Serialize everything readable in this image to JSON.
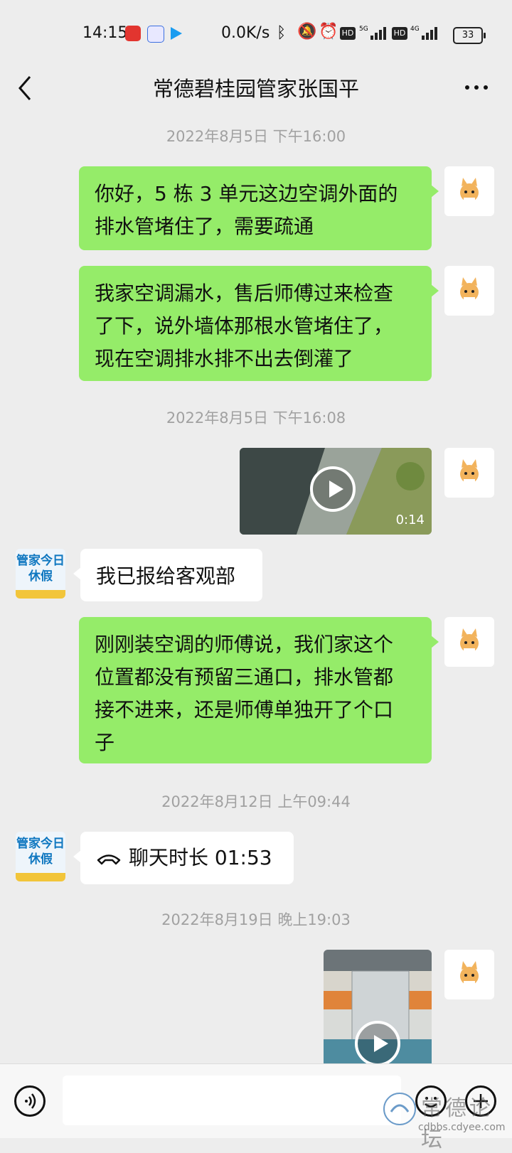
{
  "status_bar": {
    "time": "14:15",
    "speed": "0.0K/s",
    "battery": "33",
    "icons": [
      "bluetooth-icon",
      "mute-icon",
      "alarm-icon",
      "hd-icon",
      "5g-signal-icon",
      "hd-icon",
      "4g-signal-icon"
    ]
  },
  "header": {
    "title": "常德碧桂园管家张国平"
  },
  "messages": {
    "ts1": "2022年8月5日 下午16:00",
    "m1_line1": "你好，5 栋 3 单元这边空调外面的",
    "m1_line2": "排水管堵住了，需要疏通",
    "m2_line1": "我家空调漏水，售后师傅过来检查",
    "m2_line2": "了下，说外墙体那根水管堵住了，",
    "m2_line3": "现在空调排水排不出去倒灌了",
    "ts2": "2022年8月5日 下午16:08",
    "video1_duration": "0:14",
    "m3": "我已报给客观部",
    "m4_line1": "刚刚装空调的师傅说，我们家这个",
    "m4_line2": "位置都没有预留三通口，排水管都",
    "m4_line3": "接不进来，还是师傅单独开了个口",
    "m4_line4": "子",
    "ts3": "2022年8月12日 上午09:44",
    "call": "聊天时长 01:53",
    "ts4": "2022年8月19日 晚上19:03"
  },
  "avatar_other": {
    "line1": "管家今日",
    "line2": "休假"
  },
  "watermark": {
    "title": "常德论坛",
    "url": "cdbbs.cdyee.com"
  },
  "colors": {
    "my_bubble": "#95ec69",
    "their_bubble": "#ffffff",
    "background": "#ededed"
  }
}
